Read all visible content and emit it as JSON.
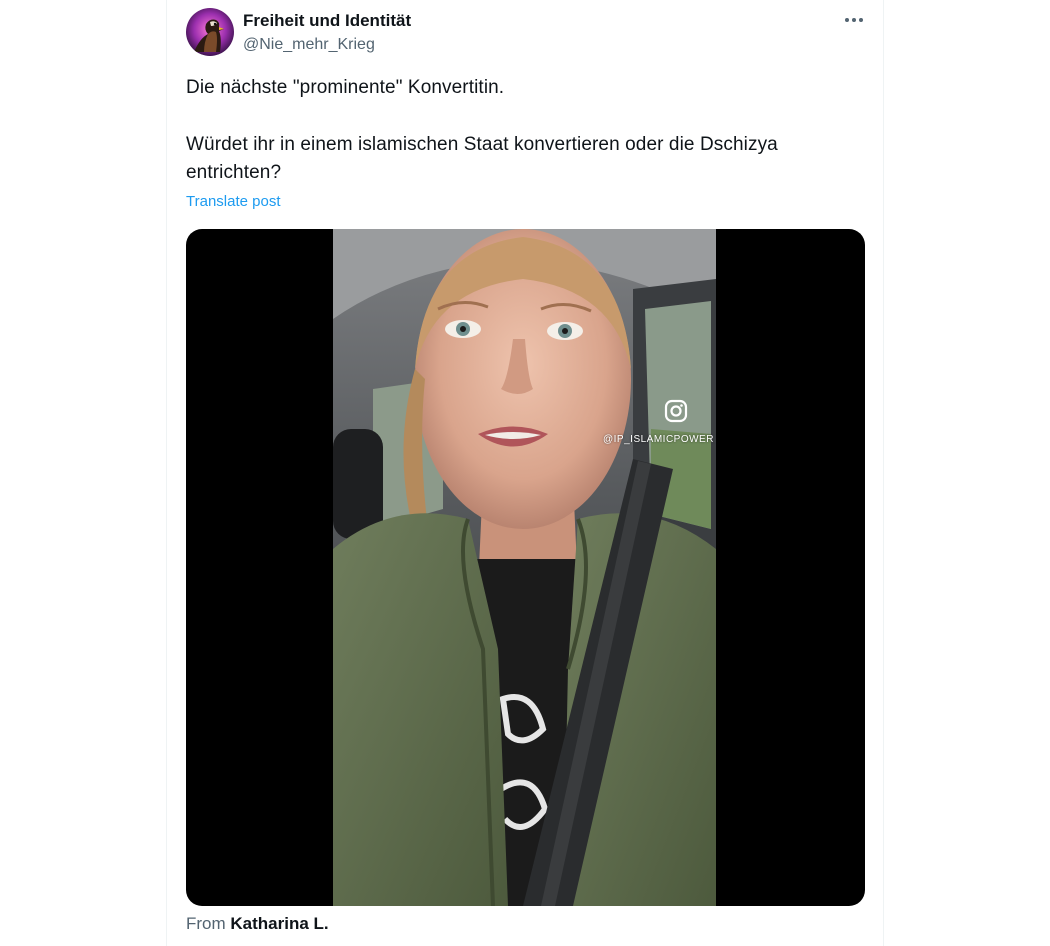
{
  "post": {
    "author": {
      "name": "Freiheit und Identität",
      "handle": "@Nie_mehr_Krieg",
      "avatar_icon": "eagle-avatar-icon"
    },
    "more_icon": "more-options-icon",
    "text_lines": [
      "Die nächste \"prominente\" Konvertitin.",
      "Würdet ihr in einem islamischen Staat konvertieren oder die Dschizya",
      "entrichten?"
    ],
    "translate_label": "Translate post",
    "media": {
      "type": "video",
      "watermark_icon": "instagram-icon",
      "watermark_handle": "@IP_ISLAMICPOWER"
    },
    "attribution": {
      "prefix": "From",
      "source": "Katharina L."
    }
  },
  "colors": {
    "text_primary": "#0f1419",
    "text_secondary": "#536471",
    "link": "#1d9bf0",
    "media_background": "#000000"
  }
}
